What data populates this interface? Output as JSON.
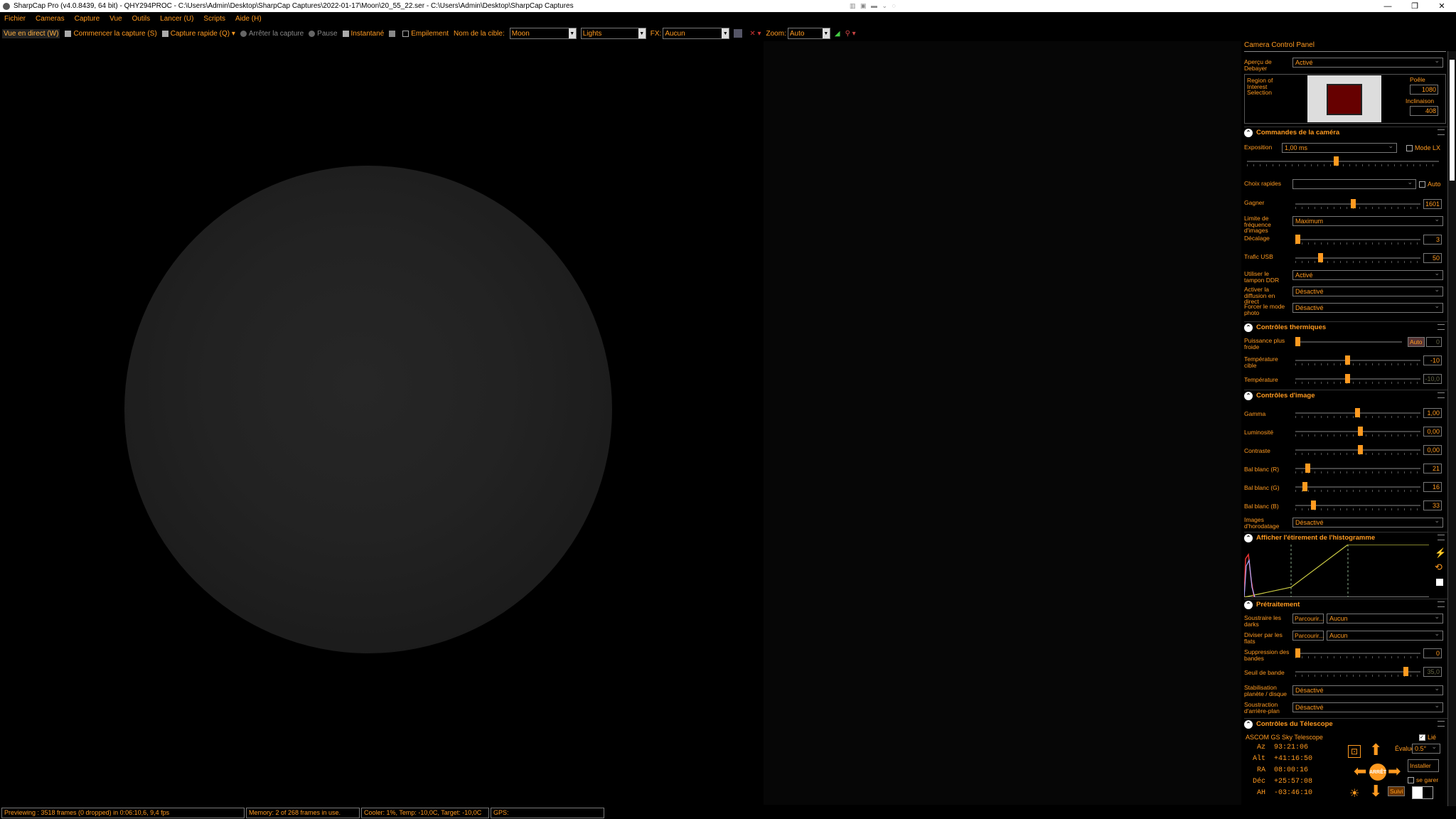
{
  "window": {
    "title": "SharpCap Pro (v4.0.8439, 64 bit) - QHY294PROC - C:\\Users\\Admin\\Desktop\\SharpCap Captures\\2022-01-17\\Moon\\20_55_22.ser - C:\\Users\\Admin\\Desktop\\SharpCap Captures",
    "mini_icons": "▥ ▣ ▬ ⌄ ◌"
  },
  "menu": [
    "Fichier",
    "Cameras",
    "Capture",
    "Vue",
    "Outils",
    "Lancer (U)",
    "Scripts",
    "Aide (H)"
  ],
  "toolbar": {
    "live_view": "Vue en direct (W)",
    "start_capture": "Commencer la capture (S)",
    "quick_capture": "Capture rapide (Q)",
    "stop_capture": "Arrêter la capture",
    "pause": "Pause",
    "snapshot": "Instantané",
    "stacking": "Empilement",
    "target_label": "Nom de la cible:",
    "target_value": "Moon",
    "frame_type": "Lights",
    "fx_label": "FX:",
    "fx_value": "Aucun",
    "zoom_label": "Zoom:",
    "zoom_value": "Auto"
  },
  "status": {
    "preview": "Previewing : 3518 frames (0 dropped) in 0:06:10,6, 9,4 fps",
    "memory": "Memory: 2 of 268 frames in use.",
    "cooler": "Cooler: 1%, Temp: -10,0C, Target: -10,0C",
    "gps": "GPS:"
  },
  "panel": {
    "title": "Camera Control Panel",
    "debayer_label": "Aperçu de Debayer",
    "debayer_value": "Activé",
    "roi_label": "Region of Interest Selection",
    "poele_label": "Poêle",
    "poele_value": "1080",
    "inclinaison_label": "Inclinaison",
    "inclinaison_value": "408",
    "camera_section": "Commandes de la caméra",
    "exposure_label": "Exposition",
    "exposure_value": "1,00 ms",
    "mode_lx": "Mode LX",
    "quick_choices": "Choix rapides",
    "auto": "Auto",
    "gain_label": "Gagner",
    "gain_value": "1601",
    "framerate_label": "Limite de fréquence d'images",
    "framerate_value": "Maximum",
    "offset_label": "Décalage",
    "offset_value": "3",
    "usb_label": "Trafic USB",
    "usb_value": "50",
    "ddr_label": "Utiliser le tampon DDR",
    "ddr_value": "Activé",
    "stream_label": "Activer la diffusion en direct",
    "stream_value": "Désactivé",
    "photo_label": "Forcer le mode photo",
    "photo_value": "Désactivé",
    "thermal_section": "Contrôles thermiques",
    "cooler_power_label": "Puissance plus froide",
    "cooler_power_value": "0",
    "target_temp_label": "Température cible",
    "target_temp_value": "-10",
    "temp_label": "Température",
    "temp_value": "-10,0",
    "image_section": "Contrôles d'image",
    "gamma_label": "Gamma",
    "gamma_value": "1,00",
    "brightness_label": "Luminosité",
    "brightness_value": "0,00",
    "contrast_label": "Contraste",
    "contrast_value": "0,00",
    "wbr_label": "Bal blanc (R)",
    "wbr_value": "21",
    "wbg_label": "Bal blanc (G)",
    "wbg_value": "16",
    "wbb_label": "Bal blanc (B)",
    "wbb_value": "33",
    "timestamp_label": "Images d'horodatage",
    "timestamp_value": "Désactivé",
    "histogram_section": "Afficher l'étirement de l'histogramme",
    "preprocess_section": "Prétraitement",
    "darks_label": "Soustraire les darks",
    "flats_label": "Diviser par les flats",
    "browse": "Parcourir...",
    "none": "Aucun",
    "banding_label": "Suppression des bandes",
    "banding_value": "0",
    "band_threshold_label": "Seuil de bande",
    "band_threshold_value": "35,0",
    "stabilize_label": "Stabilisation planète / disque",
    "stabilize_value": "Désactivé",
    "bgsub_label": "Soustraction d'arrière-plan",
    "bgsub_value": "Désactivé",
    "telescope_section": "Contrôles du Télescope",
    "scope_name": "ASCOM GS Sky Telescope",
    "linked": "Lié",
    "az_label": "Az",
    "az_value": "93:21:06",
    "alt_label": "Alt",
    "alt_value": "+41:16:50",
    "ra_label": "RA",
    "ra_value": "08:00:16",
    "dec_label": "Déc",
    "dec_value": "+25:57:08",
    "ah_label": "AH",
    "ah_value": "-03:46:10",
    "rate_label": "Évaluer",
    "rate_value": "0.5°",
    "install": "Installer",
    "park": "se garer",
    "follow": "Suivi",
    "stop": "ARRÊT"
  }
}
